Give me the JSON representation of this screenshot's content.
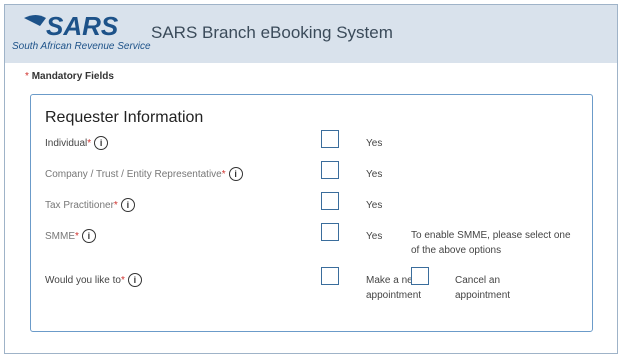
{
  "header": {
    "logo_text": "SARS",
    "logo_subtitle": "South African Revenue Service",
    "app_title": "SARS Branch eBooking System"
  },
  "form": {
    "mandatory_asterisk": "*",
    "mandatory_label": "Mandatory Fields",
    "section_title": "Requester Information",
    "rows": [
      {
        "label": "Individual",
        "option": "Yes"
      },
      {
        "label": "Company / Trust / Entity Representative",
        "option": "Yes"
      },
      {
        "label": "Tax Practitioner",
        "option": "Yes"
      },
      {
        "label": "SMME",
        "option": "Yes",
        "note": "To enable SMME, please select one of the above options"
      },
      {
        "label": "Would you like to",
        "option": "Make a new appointment",
        "option2": "Cancel an appointment"
      }
    ],
    "required_marker": "*",
    "info_glyph": "i"
  },
  "colors": {
    "header_bg": "#d9e2ec",
    "brand_blue": "#1d5289",
    "panel_border": "#6b9bc9",
    "required_red": "#d0312d"
  }
}
